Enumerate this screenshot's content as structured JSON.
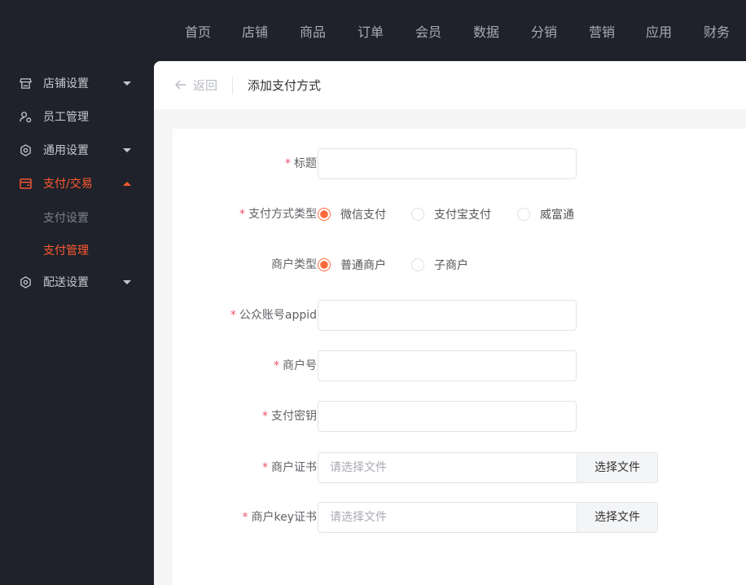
{
  "topnav": [
    "首页",
    "店铺",
    "商品",
    "订单",
    "会员",
    "数据",
    "分销",
    "营销",
    "应用",
    "财务"
  ],
  "sidebar": {
    "items": [
      {
        "label": "店铺设置",
        "icon": "store-icon"
      },
      {
        "label": "员工管理",
        "icon": "user-icon"
      },
      {
        "label": "通用设置",
        "icon": "gear-icon"
      },
      {
        "label": "支付/交易",
        "icon": "wallet-icon"
      },
      {
        "label": "配送设置",
        "icon": "gear-icon"
      }
    ],
    "sub": [
      "支付设置",
      "支付管理"
    ]
  },
  "header": {
    "back": "返回",
    "title": "添加支付方式"
  },
  "form": {
    "title_label": "标题",
    "paytype_label": "支付方式类型",
    "paytype_options": [
      "微信支付",
      "支付宝支付",
      "威富通"
    ],
    "merchant_type_label": "商户类型",
    "merchant_type_options": [
      "普通商户",
      "子商户"
    ],
    "appid_label": "公众账号appid",
    "mchid_label": "商户号",
    "key_label": "支付密钥",
    "cert_label": "商户证书",
    "keycert_label": "商户key证书",
    "file_placeholder": "请选择文件",
    "choose_file": "选择文件",
    "required_mark": "*"
  },
  "colors": {
    "accent": "#ff5a30",
    "sidebar_bg": "#1f222b"
  }
}
